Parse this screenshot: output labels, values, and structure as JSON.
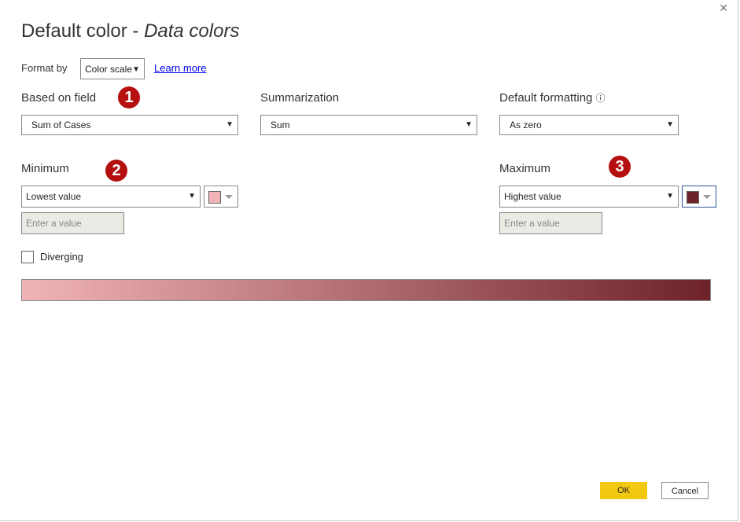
{
  "dialog": {
    "title_main": "Default color - ",
    "title_italic": "Data colors",
    "close": "✕"
  },
  "format_by": {
    "label": "Format by",
    "value": "Color scale",
    "learn_more": "Learn more"
  },
  "based_on_field": {
    "label": "Based on field",
    "value": "Sum of Cases",
    "badge": "1"
  },
  "summarization": {
    "label": "Summarization",
    "value": "Sum"
  },
  "default_formatting": {
    "label": "Default formatting",
    "info": "ⓘ",
    "value": "As zero"
  },
  "minimum": {
    "label": "Minimum",
    "value": "Lowest value",
    "placeholder": "Enter a value",
    "color": "#f0b4b8",
    "badge": "2"
  },
  "maximum": {
    "label": "Maximum",
    "value": "Highest value",
    "placeholder": "Enter a value",
    "color": "#6e2328",
    "badge": "3"
  },
  "diverging": {
    "label": "Diverging",
    "checked": false
  },
  "buttons": {
    "ok": "OK",
    "cancel": "Cancel"
  }
}
